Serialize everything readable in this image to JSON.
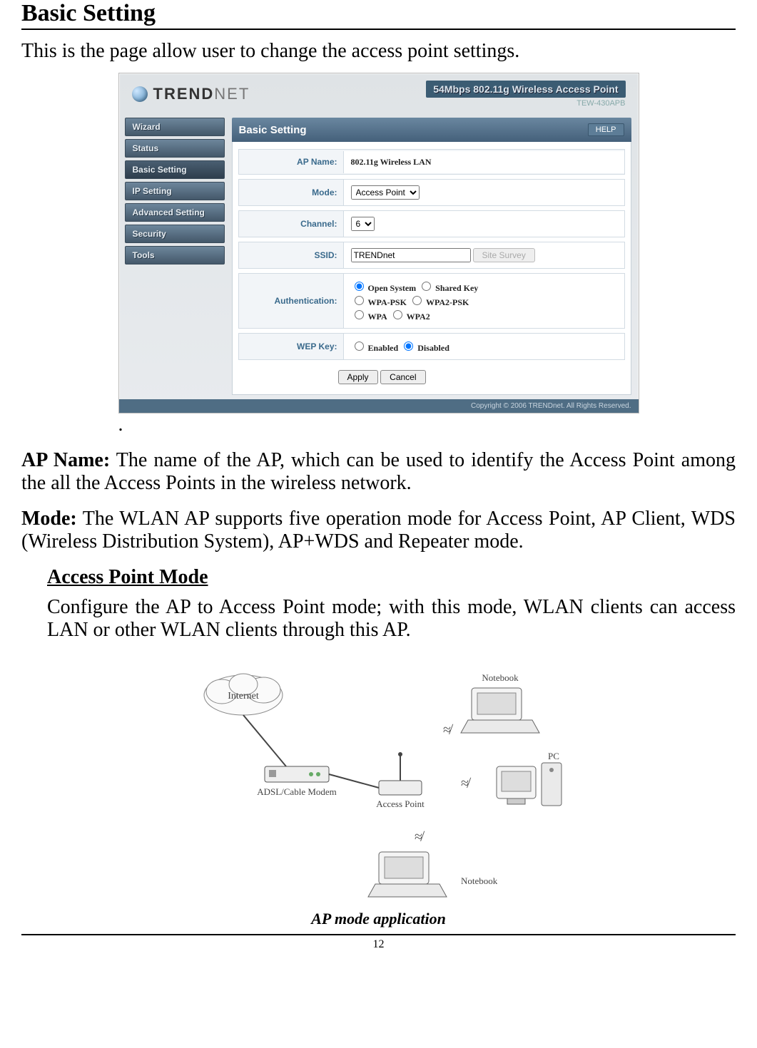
{
  "page_title": "Basic Setting",
  "intro": "This is the page allow user to change the access point settings.",
  "router": {
    "brand": "TRENDNET",
    "product": "54Mbps 802.11g Wireless Access Point",
    "model": "TEW-430APB",
    "sidebar": [
      {
        "label": "Wizard"
      },
      {
        "label": "Status"
      },
      {
        "label": "Basic Setting"
      },
      {
        "label": "IP Setting"
      },
      {
        "label": "Advanced Setting"
      },
      {
        "label": "Security"
      },
      {
        "label": "Tools"
      }
    ],
    "panel_title": "Basic Setting",
    "help": "HELP",
    "fields": {
      "ap_name": {
        "label": "AP Name:",
        "value": "802.11g Wireless LAN"
      },
      "mode": {
        "label": "Mode:",
        "value": "Access Point"
      },
      "channel": {
        "label": "Channel:",
        "value": "6"
      },
      "ssid": {
        "label": "SSID:",
        "value": "TRENDnet",
        "survey": "Site Survey"
      },
      "auth": {
        "label": "Authentication:",
        "options": [
          "Open System",
          "Shared Key",
          "WPA-PSK",
          "WPA2-PSK",
          "WPA",
          "WPA2"
        ],
        "selected": "Open System"
      },
      "wep": {
        "label": "WEP Key:",
        "options": [
          "Enabled",
          "Disabled"
        ],
        "selected": "Disabled"
      }
    },
    "buttons": {
      "apply": "Apply",
      "cancel": "Cancel"
    },
    "copyright": "Copyright © 2006 TRENDnet. All Rights Reserved."
  },
  "after_router_dot": ".",
  "ap_name_desc": {
    "label": "AP Name:",
    "text": " The name of the AP, which can be used to identify the Access Point among the all the Access Points in the wireless network."
  },
  "mode_desc": {
    "label": "Mode:",
    "text": " The WLAN AP supports five operation mode for Access Point, AP Client, WDS (Wireless Distribution System), AP+WDS and Repeater mode."
  },
  "apmode": {
    "heading": "Access Point Mode",
    "text": "Configure the AP to Access Point mode; with this mode, WLAN clients can access LAN or other WLAN clients through this AP."
  },
  "diagram": {
    "internet": "Internet",
    "modem": "ADSL/Cable Modem",
    "ap": "Access Point",
    "notebook1": "Notebook",
    "notebook2": "Notebook",
    "pc": "PC"
  },
  "caption": "AP mode application",
  "page_number": "12"
}
